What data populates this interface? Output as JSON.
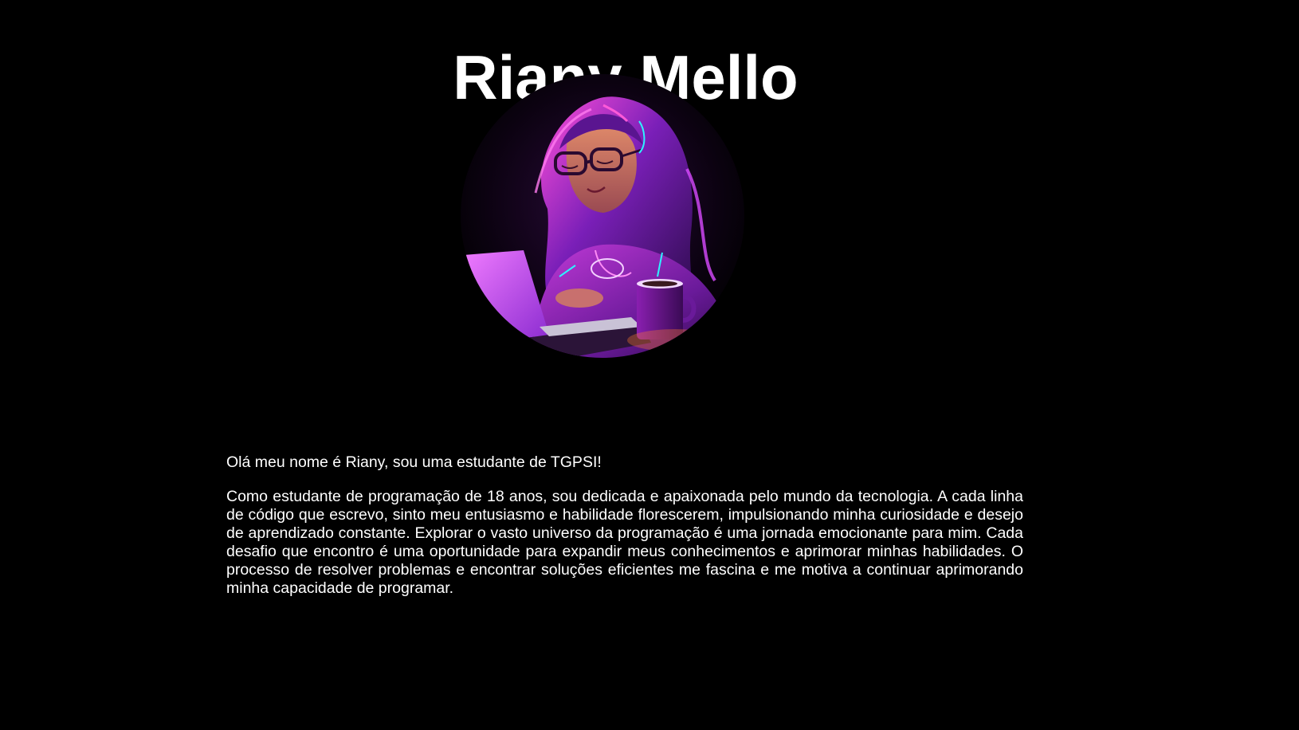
{
  "header": {
    "title": "Riany Mello"
  },
  "portrait": {
    "alt": "Ilustração de uma jovem com óculos e cabelo cacheado programando num portátil, iluminada em neon roxo e rosa"
  },
  "about": {
    "intro": "Olá meu nome é Riany, sou uma estudante de TGPSI!",
    "bio": "Como estudante de programação de 18 anos, sou dedicada e apaixonada pelo mundo da tecnologia. A cada linha de código que escrevo, sinto meu entusiasmo e habilidade florescerem, impulsionando minha curiosidade e desejo de aprendizado constante. Explorar o vasto universo da programação é uma jornada emocionante para mim. Cada desafio que encontro é uma oportunidade para expandir meus conhecimentos e aprimorar minhas habilidades. O processo de resolver problemas e encontrar soluções eficientes me fascina e me motiva a continuar aprimorando minha capacidade de programar."
  },
  "colors": {
    "background": "#000000",
    "text": "#ffffff",
    "neon_purple": "#b026ff",
    "neon_pink": "#ff3cd7",
    "neon_cyan": "#2ef2ff"
  }
}
